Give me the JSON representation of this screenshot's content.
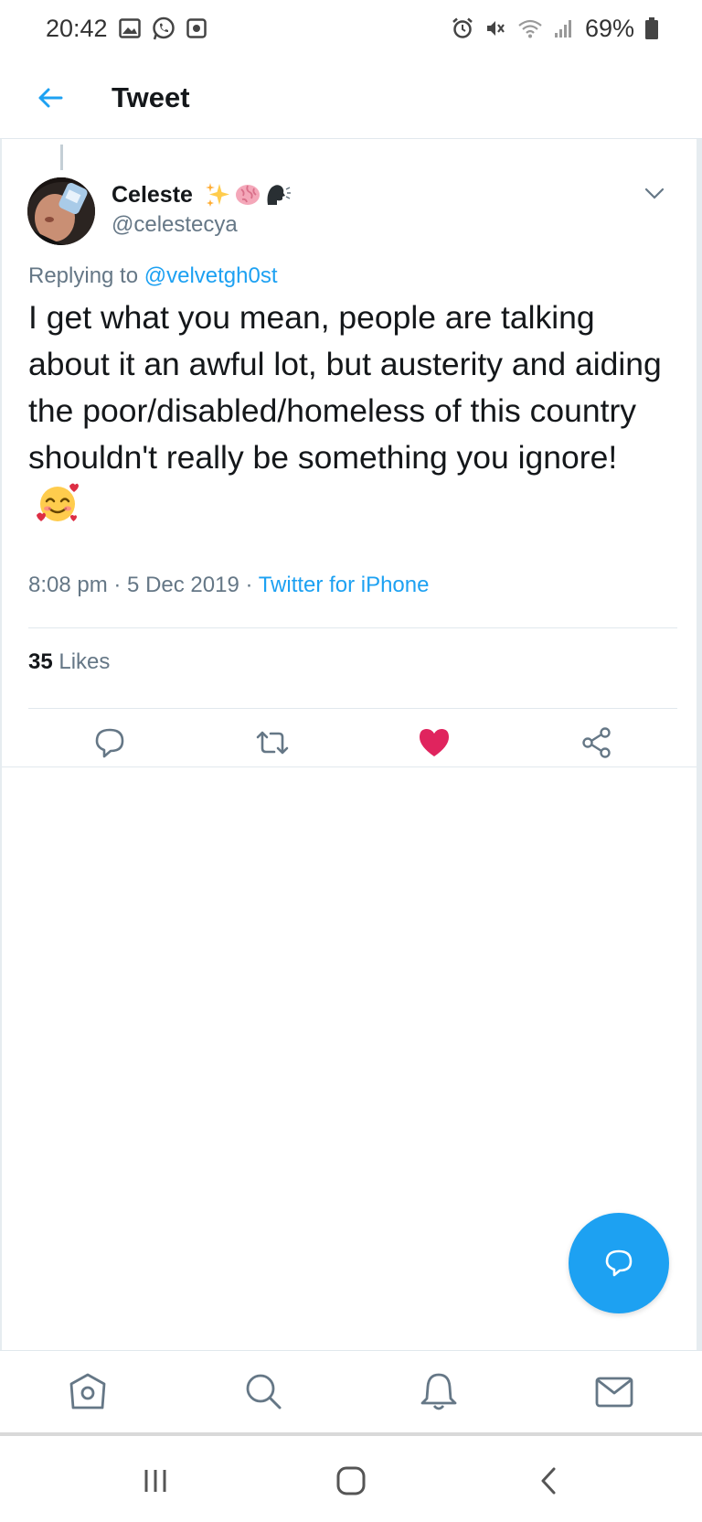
{
  "status_bar": {
    "time": "20:42",
    "battery_percent": "69%",
    "left_icons": [
      "gallery-icon",
      "whatsapp-icon",
      "screen-record-icon"
    ],
    "right_icons": [
      "alarm-icon",
      "mute-icon",
      "wifi-icon",
      "signal-icon",
      "battery-icon"
    ]
  },
  "header": {
    "title": "Tweet",
    "back_icon": "arrow-left-icon"
  },
  "tweet": {
    "display_name": "Celeste",
    "name_emojis": [
      "sparkles-emoji",
      "brain-emoji",
      "speaking-head-emoji"
    ],
    "handle": "@celestecya",
    "replying_prefix": "Replying to",
    "replying_to": "@velvetgh0st",
    "text": "I get what you mean, people are talking about it an awful lot, but austerity and aiding the poor/disabled/homeless of this country shouldn't really be something you ignore!",
    "text_emoji": "smiling-face-with-hearts-emoji",
    "time": "8:08 pm",
    "separator": " · ",
    "date": "5 Dec 2019",
    "source": "Twitter for iPhone",
    "likes_count": "35",
    "likes_label": "Likes",
    "liked": true
  },
  "actions": [
    "reply-icon",
    "retweet-icon",
    "like-icon",
    "share-icon"
  ],
  "colors": {
    "brand_blue": "#1da1f2",
    "like_red": "#e0245e",
    "secondary_text": "#657786",
    "divider": "#e1e8ed"
  },
  "bottom_nav": [
    "home-icon",
    "search-icon",
    "notifications-icon",
    "messages-icon"
  ],
  "system_nav": [
    "recents-icon",
    "home-button-icon",
    "back-icon"
  ]
}
